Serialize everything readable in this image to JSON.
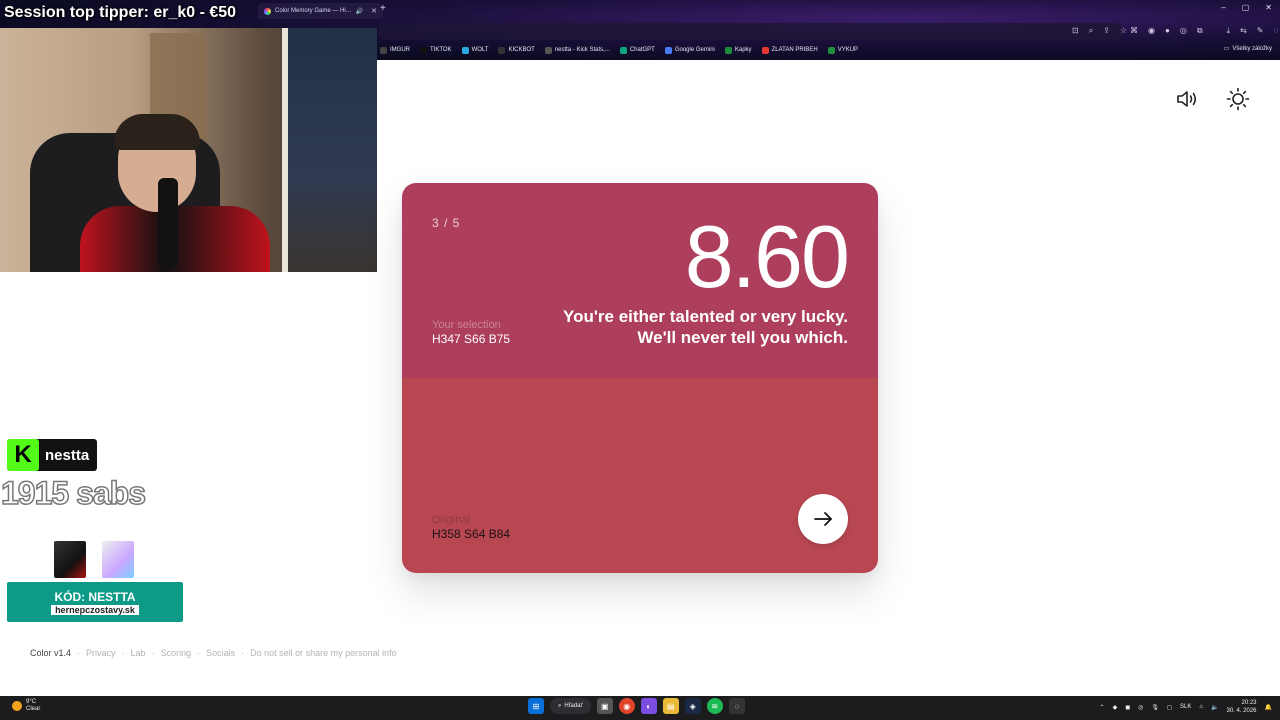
{
  "stream": {
    "title": "Session top tipper: er_k0 - €50",
    "kick_name": "nestta",
    "subs": "1915 sabs",
    "promo_code": "KÓD: NESTTA",
    "promo_site": "hernepczostavy.sk"
  },
  "browser": {
    "tabs": [
      {
        "label": "Color Memory Game — Hi…",
        "active": true
      }
    ],
    "bookmarks": [
      "IMGUR",
      "TIKTOK",
      "WOLT",
      "KICKBOT",
      "nestta - Kick Stats,...",
      "ChatGPT",
      "Google Gemini",
      "Kapky",
      "ZLATAN PRIBEH",
      "VYKUP"
    ],
    "bookmark_colors": [
      "#444444",
      "#111111",
      "#2aa6e0",
      "#333333",
      "#555555",
      "#10a37f",
      "#4a7bf5",
      "#1e8e3e",
      "#e53935",
      "#1e8e3e"
    ],
    "all_bookmarks": "Všetky záložky"
  },
  "game": {
    "round": "3 / 5",
    "score": "8.60",
    "message": "You're either talented or very lucky. We'll never tell you which.",
    "selection_label": "Your selection",
    "selection_value": "H347 S66 B75",
    "original_label": "Original",
    "original_value": "H358 S64 B84",
    "selection_color": "#ae3f5c",
    "original_color": "#b84752"
  },
  "footer": {
    "brand": "Color v1.4",
    "links": [
      "Privacy",
      "Lab",
      "Scoring",
      "Socials",
      "Do not sell or share my personal info"
    ],
    "separator": "·"
  },
  "taskbar": {
    "weather_temp": "9°C",
    "weather_desc": "Clear",
    "search": "Hľadať",
    "lang": "SLK",
    "time": "20:23",
    "date": "30. 4. 2026"
  }
}
